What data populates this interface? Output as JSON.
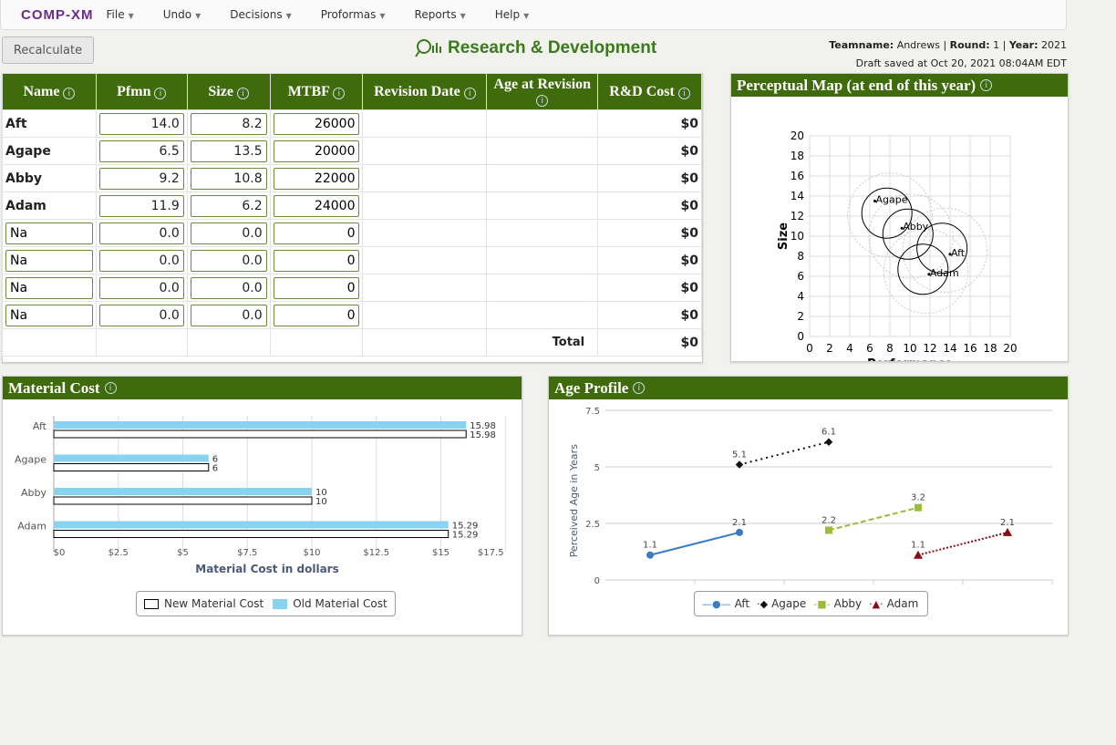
{
  "nav": {
    "logo": "COMP-XM",
    "menus": [
      "File",
      "Undo",
      "Decisions",
      "Proformas",
      "Reports",
      "Help"
    ]
  },
  "toolbar": {
    "recalculate_label": "Recalculate"
  },
  "page": {
    "title": "Research & Development",
    "team_label": "Teamname:",
    "team": "Andrews",
    "round_label": "Round:",
    "round": "1",
    "year_label": "Year:",
    "year": "2021",
    "draft": "Draft saved at Oct 20, 2021 08:04AM EDT"
  },
  "table": {
    "headers": [
      "Name",
      "Pfmn",
      "Size",
      "MTBF",
      "Revision Date",
      "Age at Revision",
      "R&D Cost"
    ],
    "rows": [
      {
        "name": "Aft",
        "pfmn": "14.0",
        "size": "8.2",
        "mtbf": "26000",
        "rev": "",
        "age": "",
        "cost": "$0",
        "editable_name": false
      },
      {
        "name": "Agape",
        "pfmn": "6.5",
        "size": "13.5",
        "mtbf": "20000",
        "rev": "",
        "age": "",
        "cost": "$0",
        "editable_name": false
      },
      {
        "name": "Abby",
        "pfmn": "9.2",
        "size": "10.8",
        "mtbf": "22000",
        "rev": "",
        "age": "",
        "cost": "$0",
        "editable_name": false
      },
      {
        "name": "Adam",
        "pfmn": "11.9",
        "size": "6.2",
        "mtbf": "24000",
        "rev": "",
        "age": "",
        "cost": "$0",
        "editable_name": false
      },
      {
        "name": "Na",
        "pfmn": "0.0",
        "size": "0.0",
        "mtbf": "0",
        "rev": "",
        "age": "",
        "cost": "$0",
        "editable_name": true
      },
      {
        "name": "Na",
        "pfmn": "0.0",
        "size": "0.0",
        "mtbf": "0",
        "rev": "",
        "age": "",
        "cost": "$0",
        "editable_name": true
      },
      {
        "name": "Na",
        "pfmn": "0.0",
        "size": "0.0",
        "mtbf": "0",
        "rev": "",
        "age": "",
        "cost": "$0",
        "editable_name": true
      },
      {
        "name": "Na",
        "pfmn": "0.0",
        "size": "0.0",
        "mtbf": "0",
        "rev": "",
        "age": "",
        "cost": "$0",
        "editable_name": true
      }
    ],
    "total_label": "Total",
    "total": "$0"
  },
  "colors": {
    "header_green": "#3f6b0c",
    "title_green": "#3a7a1a",
    "old_cost": "#87d3f0",
    "aft": "#3a7cc4",
    "agape": "#111111",
    "abby": "#9bbb3a",
    "adam": "#8b0a14"
  },
  "chart_data": [
    {
      "title": "Perceptual Map (at end of this year)",
      "type": "scatter",
      "xlabel": "Performance",
      "ylabel": "Size",
      "xlim": [
        0,
        20
      ],
      "ylim": [
        0,
        20
      ],
      "xticks": [
        0,
        2,
        4,
        6,
        8,
        10,
        12,
        14,
        16,
        18,
        20
      ],
      "yticks": [
        0,
        2,
        4,
        6,
        8,
        10,
        12,
        14,
        16,
        18,
        20
      ],
      "grid": true,
      "points": [
        {
          "name": "Agape",
          "x": 6.5,
          "y": 13.5
        },
        {
          "name": "Abby",
          "x": 9.2,
          "y": 10.8
        },
        {
          "name": "Aft",
          "x": 14.0,
          "y": 8.2
        },
        {
          "name": "Adam",
          "x": 11.9,
          "y": 6.2
        }
      ],
      "segment_circles": [
        {
          "x": 7.7,
          "y": 12.3
        },
        {
          "x": 9.8,
          "y": 10.2
        },
        {
          "x": 13.2,
          "y": 8.8
        },
        {
          "x": 11.3,
          "y": 6.7
        }
      ]
    },
    {
      "title": "Material Cost",
      "type": "bar",
      "xlabel": "Material Cost in dollars",
      "xlim": [
        0,
        17.5
      ],
      "xticks": [
        "$0",
        "$2.5",
        "$5",
        "$7.5",
        "$10",
        "$12.5",
        "$15",
        "$17.5"
      ],
      "categories": [
        "Aft",
        "Agape",
        "Abby",
        "Adam"
      ],
      "series": [
        {
          "name": "Old Material Cost",
          "values": [
            15.98,
            6,
            10,
            15.29
          ]
        },
        {
          "name": "New Material Cost",
          "values": [
            15.98,
            6,
            10,
            15.29
          ]
        }
      ],
      "legend": "bottom"
    },
    {
      "title": "Age Profile",
      "type": "line",
      "ylabel": "Perceived Age in Years",
      "ylim": [
        0,
        7.5
      ],
      "yticks": [
        "0",
        "2.5",
        "5",
        "7.5"
      ],
      "legend": "bottom",
      "series": [
        {
          "name": "Aft",
          "values": [
            1.1,
            2.1
          ],
          "start": 0
        },
        {
          "name": "Agape",
          "values": [
            5.1,
            6.1
          ],
          "start": 1
        },
        {
          "name": "Abby",
          "values": [
            2.2,
            3.2
          ],
          "start": 2
        },
        {
          "name": "Adam",
          "values": [
            1.1,
            2.1
          ],
          "start": 3
        }
      ]
    }
  ]
}
